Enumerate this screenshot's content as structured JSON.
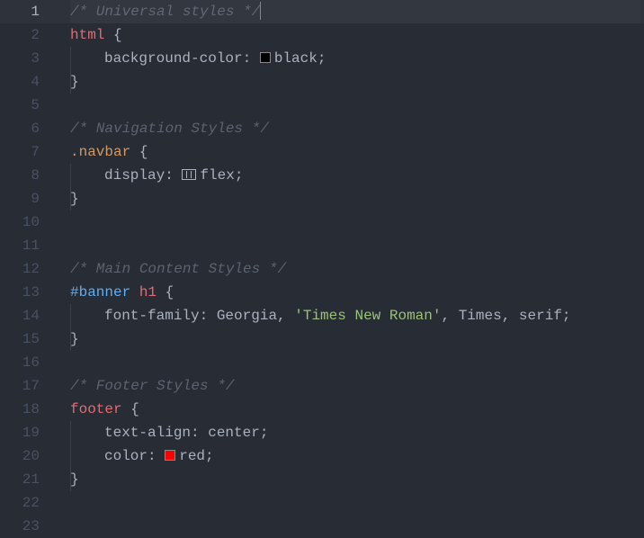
{
  "language": "css",
  "cursor_line": 1,
  "lines": [
    {
      "n": 1,
      "indent": 0,
      "active": true,
      "tokens": [
        {
          "t": "comment",
          "v": "/* Universal styles */"
        }
      ],
      "cursor_after": true
    },
    {
      "n": 2,
      "indent": 0,
      "tokens": [
        {
          "t": "tag",
          "v": "html"
        },
        {
          "t": "punc",
          "v": " "
        },
        {
          "t": "brace",
          "v": "{"
        }
      ]
    },
    {
      "n": 3,
      "indent": 1,
      "tokens": [
        {
          "t": "prop",
          "v": "background-color"
        },
        {
          "t": "punc",
          "v": ": "
        },
        {
          "t": "swatch",
          "v": "black"
        },
        {
          "t": "value",
          "v": "black"
        },
        {
          "t": "punc",
          "v": ";"
        }
      ]
    },
    {
      "n": 4,
      "indent": 0,
      "tokens": [
        {
          "t": "brace",
          "v": "}"
        }
      ]
    },
    {
      "n": 5,
      "indent": 0,
      "tokens": []
    },
    {
      "n": 6,
      "indent": 0,
      "tokens": [
        {
          "t": "comment",
          "v": "/* Navigation Styles */"
        }
      ]
    },
    {
      "n": 7,
      "indent": 0,
      "tokens": [
        {
          "t": "class",
          "v": ".navbar"
        },
        {
          "t": "punc",
          "v": " "
        },
        {
          "t": "brace",
          "v": "{"
        }
      ]
    },
    {
      "n": 8,
      "indent": 1,
      "tokens": [
        {
          "t": "prop",
          "v": "display"
        },
        {
          "t": "punc",
          "v": ": "
        },
        {
          "t": "flexicon",
          "v": "flex"
        },
        {
          "t": "value",
          "v": "flex"
        },
        {
          "t": "punc",
          "v": ";"
        }
      ]
    },
    {
      "n": 9,
      "indent": 0,
      "tokens": [
        {
          "t": "brace",
          "v": "}"
        }
      ]
    },
    {
      "n": 10,
      "indent": 0,
      "tokens": []
    },
    {
      "n": 11,
      "indent": 0,
      "tokens": []
    },
    {
      "n": 12,
      "indent": 0,
      "tokens": [
        {
          "t": "comment",
          "v": "/* Main Content Styles */"
        }
      ]
    },
    {
      "n": 13,
      "indent": 0,
      "tokens": [
        {
          "t": "id",
          "v": "#banner"
        },
        {
          "t": "punc",
          "v": " "
        },
        {
          "t": "tag",
          "v": "h1"
        },
        {
          "t": "punc",
          "v": " "
        },
        {
          "t": "brace",
          "v": "{"
        }
      ]
    },
    {
      "n": 14,
      "indent": 1,
      "tokens": [
        {
          "t": "prop",
          "v": "font-family"
        },
        {
          "t": "punc",
          "v": ": "
        },
        {
          "t": "value",
          "v": "Georgia"
        },
        {
          "t": "punc",
          "v": ", "
        },
        {
          "t": "string",
          "v": "'Times New Roman'"
        },
        {
          "t": "punc",
          "v": ", "
        },
        {
          "t": "value",
          "v": "Times"
        },
        {
          "t": "punc",
          "v": ", "
        },
        {
          "t": "value",
          "v": "serif"
        },
        {
          "t": "punc",
          "v": ";"
        }
      ]
    },
    {
      "n": 15,
      "indent": 0,
      "tokens": [
        {
          "t": "brace",
          "v": "}"
        }
      ]
    },
    {
      "n": 16,
      "indent": 0,
      "tokens": []
    },
    {
      "n": 17,
      "indent": 0,
      "tokens": [
        {
          "t": "comment",
          "v": "/* Footer Styles */"
        }
      ]
    },
    {
      "n": 18,
      "indent": 0,
      "tokens": [
        {
          "t": "tag",
          "v": "footer"
        },
        {
          "t": "punc",
          "v": " "
        },
        {
          "t": "brace",
          "v": "{"
        }
      ]
    },
    {
      "n": 19,
      "indent": 1,
      "tokens": [
        {
          "t": "prop",
          "v": "text-align"
        },
        {
          "t": "punc",
          "v": ": "
        },
        {
          "t": "value",
          "v": "center"
        },
        {
          "t": "punc",
          "v": ";"
        }
      ]
    },
    {
      "n": 20,
      "indent": 1,
      "tokens": [
        {
          "t": "prop",
          "v": "color"
        },
        {
          "t": "punc",
          "v": ": "
        },
        {
          "t": "swatch",
          "v": "red"
        },
        {
          "t": "value",
          "v": "red"
        },
        {
          "t": "punc",
          "v": ";"
        }
      ]
    },
    {
      "n": 21,
      "indent": 0,
      "tokens": [
        {
          "t": "brace",
          "v": "}"
        }
      ]
    },
    {
      "n": 22,
      "indent": 0,
      "tokens": []
    },
    {
      "n": 23,
      "indent": 0,
      "tokens": []
    }
  ]
}
